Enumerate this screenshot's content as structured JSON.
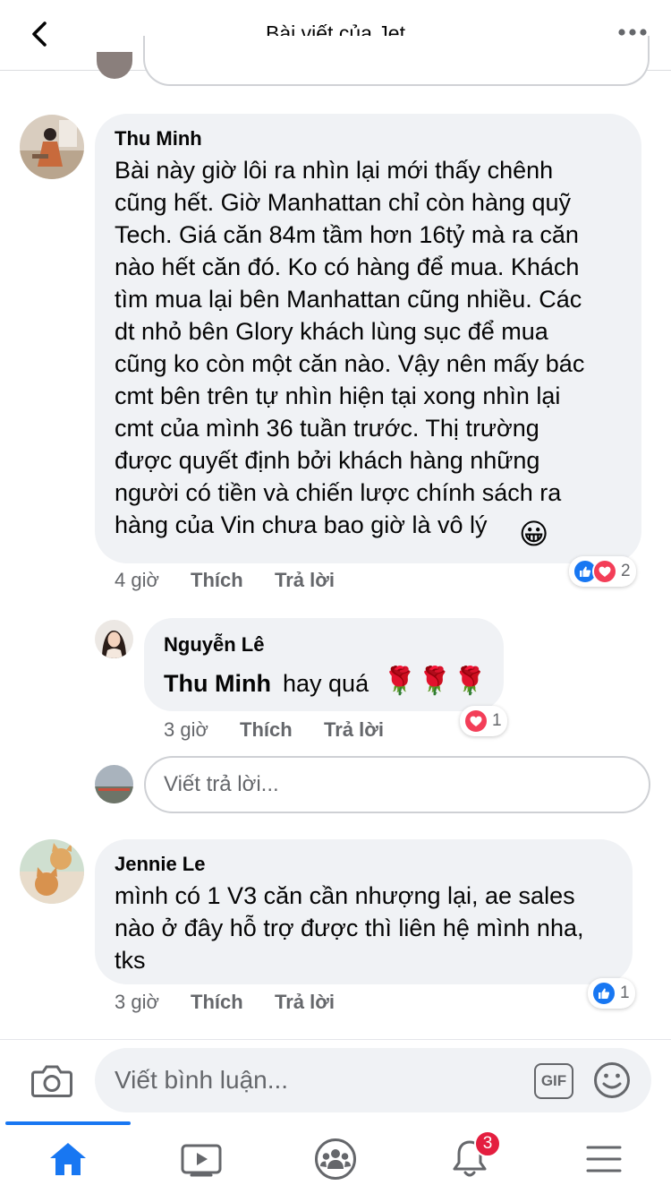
{
  "header": {
    "title": "Bài viết của Jet",
    "back_icon": "chevron-left-icon",
    "more_icon": "more-horizontal-icon"
  },
  "comments": [
    {
      "author": "Thu Minh",
      "text": "Bài này giờ lôi ra nhìn lại mới thấy chênh\ncũng hết. Giờ Manhattan chỉ còn hàng quỹ\nTech. Giá căn 84m tầm hơn 16tỷ mà ra căn\nnào hết căn đó. Ko có hàng để mua. Khách\ntìm mua lại bên Manhattan cũng nhiều. Các\ndt nhỏ bên Glory khách lùng sục để mua\ncũng ko còn một căn nào. Vậy nên mấy bác\ncmt bên trên tự nhìn hiện tại xong nhìn lại\ncmt của mình 36 tuần trước. Thị trường\nđược quyết định bởi khách hàng những\nngười có tiền và chiến lược chính sách ra\nhàng của Vin chưa bao giờ là vô lý",
      "emoji": "😀",
      "time": "4 giờ",
      "like_label": "Thích",
      "reply_label": "Trả lời",
      "reaction_count": "2"
    },
    {
      "author": "Nguyễn Lê",
      "mention": "Thu Minh",
      "text": "hay quá",
      "emoji": "🌹🌹🌹",
      "time": "3 giờ",
      "like_label": "Thích",
      "reply_label": "Trả lời",
      "reaction_count": "1"
    },
    {
      "author": "Jennie Le",
      "text": "mình có 1 V3 căn cần nhượng lại, ae sales\nnào ở đây hỗ trợ được thì liên hệ mình nha,\ntks",
      "time": "3 giờ",
      "like_label": "Thích",
      "reply_label": "Trả lời",
      "reaction_count": "1"
    }
  ],
  "reply_input": {
    "placeholder": "Viết trả lời..."
  },
  "composer": {
    "placeholder": "Viết bình luận...",
    "gif_label": "GIF",
    "camera_icon": "camera-icon",
    "emoji_icon": "smiley-icon"
  },
  "tabbar": {
    "items": [
      "home-icon",
      "video-icon",
      "groups-icon",
      "notifications-icon",
      "menu-icon"
    ],
    "notification_badge": "3",
    "accent": "#1877f2"
  },
  "colors": {
    "like": "#1877f2",
    "love": "#f33e58",
    "bubble": "#f0f2f5",
    "secondary_text": "#65676b"
  }
}
